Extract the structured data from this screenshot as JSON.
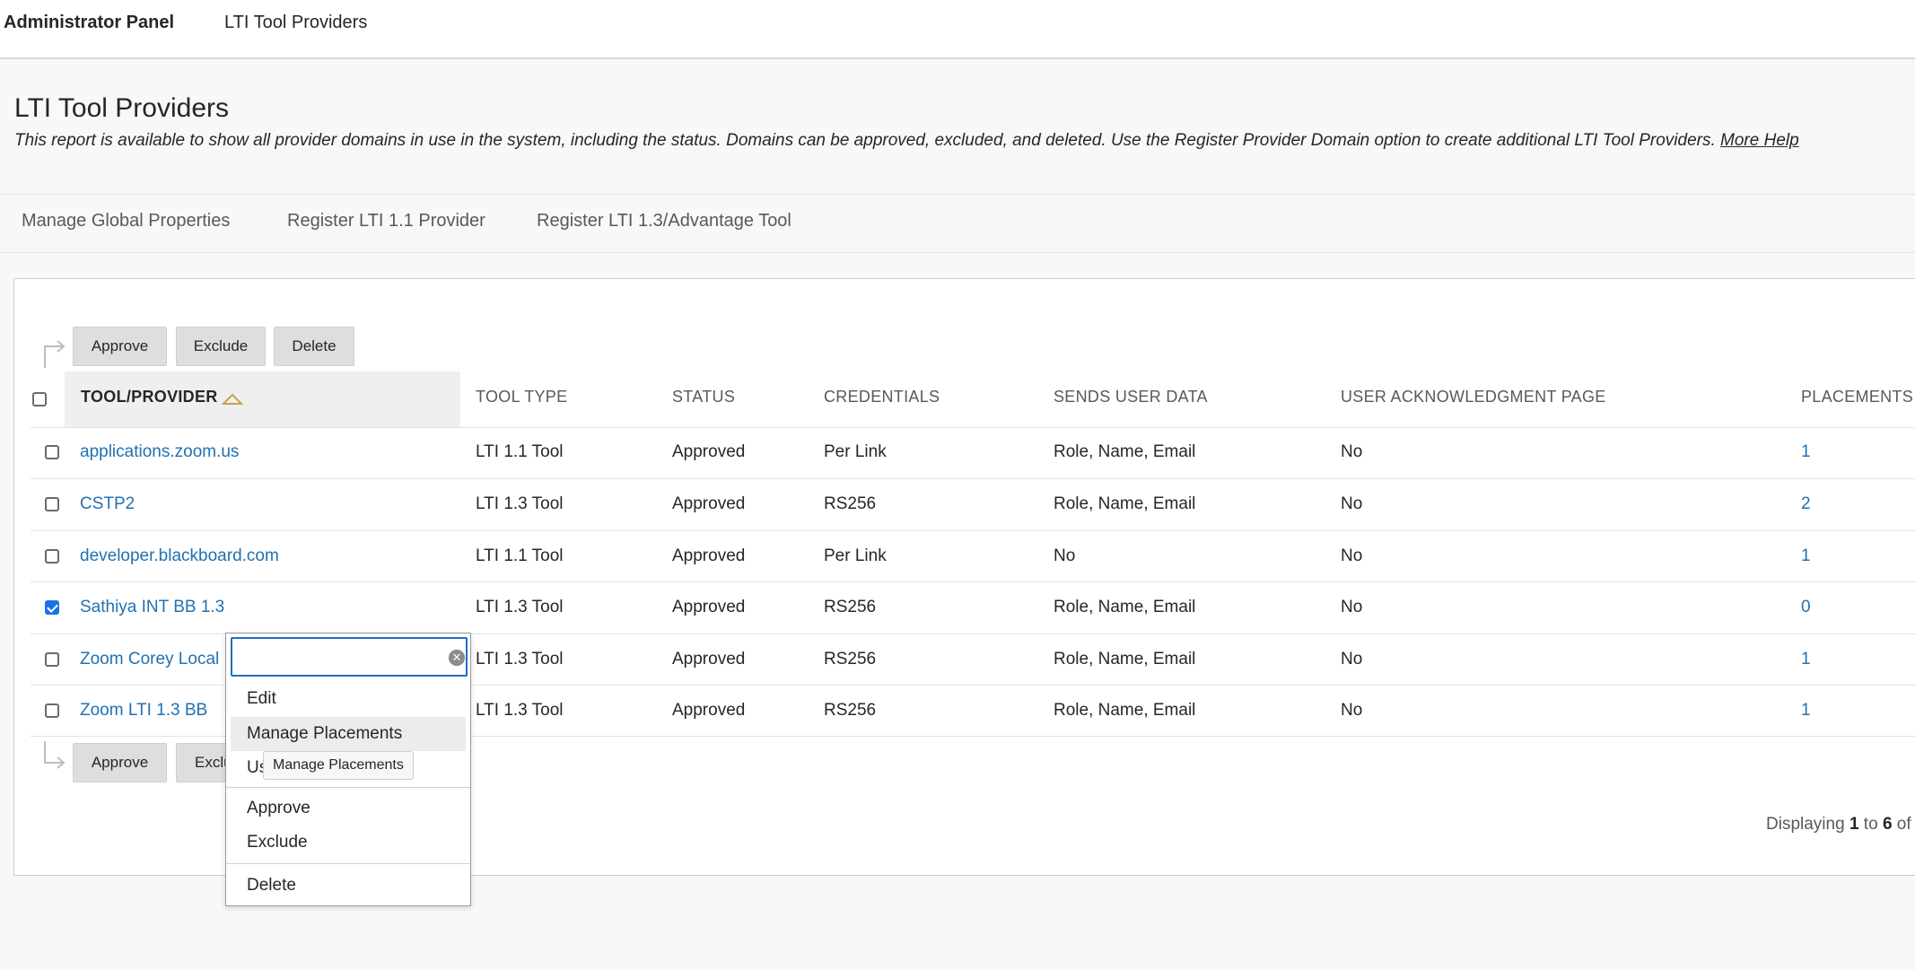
{
  "breadcrumb": {
    "admin_panel": "Administrator Panel",
    "current": "LTI Tool Providers"
  },
  "page": {
    "title": "LTI Tool Providers",
    "description": "This report is available to show all provider domains in use in the system, including the status. Domains can be approved, excluded, and deleted. Use the Register Provider Domain option to create additional LTI Tool Providers.",
    "more_help": "More Help"
  },
  "actions": {
    "manage_global": "Manage Global Properties",
    "register_11": "Register LTI 1.1 Provider",
    "register_13": "Register LTI 1.3/Advantage Tool"
  },
  "bulk": {
    "approve": "Approve",
    "exclude": "Exclude",
    "exclude_partial": "Exclu",
    "delete": "Delete"
  },
  "table": {
    "headers": {
      "tool_provider": "TOOL/PROVIDER",
      "tool_type": "TOOL TYPE",
      "status": "STATUS",
      "credentials": "CREDENTIALS",
      "sends_user_data": "SENDS USER DATA",
      "user_ack": "USER ACKNOWLEDGMENT PAGE",
      "placements": "PLACEMENTS"
    },
    "rows": [
      {
        "name": "applications.zoom.us",
        "type": "LTI 1.1 Tool",
        "status": "Approved",
        "credentials": "Per Link",
        "sends": "Role, Name, Email",
        "ack": "No",
        "placements": "1",
        "checked": false
      },
      {
        "name": "CSTP2",
        "type": "LTI 1.3 Tool",
        "status": "Approved",
        "credentials": "RS256",
        "sends": "Role, Name, Email",
        "ack": "No",
        "placements": "2",
        "checked": false
      },
      {
        "name": "developer.blackboard.com",
        "type": "LTI 1.1 Tool",
        "status": "Approved",
        "credentials": "Per Link",
        "sends": "No",
        "ack": "No",
        "placements": "1",
        "checked": false
      },
      {
        "name": "Sathiya INT BB 1.3",
        "type": "LTI 1.3 Tool",
        "status": "Approved",
        "credentials": "RS256",
        "sends": "Role, Name, Email",
        "ack": "No",
        "placements": "0",
        "checked": true
      },
      {
        "name": "Zoom Corey Local",
        "type": "LTI 1.3 Tool",
        "status": "Approved",
        "credentials": "RS256",
        "sends": "Role, Name, Email",
        "ack": "No",
        "placements": "1",
        "checked": false
      },
      {
        "name": "Zoom LTI 1.3 BB",
        "type": "LTI 1.3 Tool",
        "status": "Approved",
        "credentials": "RS256",
        "sends": "Role, Name, Email",
        "ack": "No",
        "placements": "1",
        "checked": false
      }
    ]
  },
  "pagination": {
    "prefix": "Displaying",
    "from": "1",
    "to_word": "to",
    "to": "6",
    "of_word": "of"
  },
  "context_menu": {
    "search_value": "",
    "items": {
      "edit": "Edit",
      "manage_placements": "Manage Placements",
      "partial": "Us",
      "approve": "Approve",
      "exclude": "Exclude",
      "delete": "Delete"
    },
    "tooltip": "Manage Placements"
  },
  "colors": {
    "link": "#2271b1",
    "focus": "#1e6fbf",
    "checkbox_checked": "#1a73e8"
  }
}
